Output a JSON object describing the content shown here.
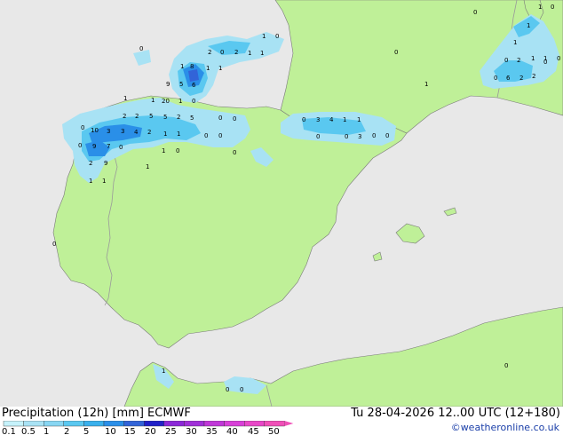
{
  "title": "Precipitation (12h) [mm] ECMWF",
  "datetime": "Tu 28-04-2026 12..00 UTC (12+180)",
  "credit": "©weatheronline.co.uk",
  "colors": {
    "sea": "#e8e8e8",
    "land": "#bff098",
    "light_precip": "#a8e2f4",
    "mid_precip": "#5ac8f0",
    "heavy_precip": "#2a8fe8",
    "very_heavy_precip": "#3264d8",
    "border": "#9a9a9a",
    "coast": "#7a7a7a"
  },
  "legend": {
    "labels": [
      "0.1",
      "0.5",
      "1",
      "2",
      "5",
      "10",
      "15",
      "20",
      "25",
      "30",
      "35",
      "40",
      "45",
      "50"
    ],
    "colors": [
      "#c6f2fb",
      "#a8e2f4",
      "#88d6f2",
      "#5ac8f0",
      "#3ab0ec",
      "#2a8fe8",
      "#3264d8",
      "#2020c8",
      "#8c28d8",
      "#a030d8",
      "#c038d8",
      "#d840d8",
      "#e848c8",
      "#f050b8"
    ]
  },
  "values": [
    {
      "t": "1"
    },
    {
      "t": "0"
    },
    {
      "t": "0"
    },
    {
      "t": "2"
    },
    {
      "t": "2"
    },
    {
      "t": "1"
    },
    {
      "t": "1"
    },
    {
      "t": "0"
    },
    {
      "t": "0"
    },
    {
      "t": "1"
    },
    {
      "t": "8"
    },
    {
      "t": "1"
    },
    {
      "t": "1"
    },
    {
      "t": "9"
    },
    {
      "t": "5"
    },
    {
      "t": "6"
    },
    {
      "t": "1"
    },
    {
      "t": "1"
    },
    {
      "t": "20"
    },
    {
      "t": "1"
    },
    {
      "t": "0"
    },
    {
      "t": "2"
    },
    {
      "t": "2"
    },
    {
      "t": "5"
    },
    {
      "t": "5"
    },
    {
      "t": "2"
    },
    {
      "t": "5"
    },
    {
      "t": "0"
    },
    {
      "t": "0"
    },
    {
      "t": "0"
    },
    {
      "t": "10"
    },
    {
      "t": "3"
    },
    {
      "t": "3"
    },
    {
      "t": "4"
    },
    {
      "t": "2"
    },
    {
      "t": "1"
    },
    {
      "t": "1"
    },
    {
      "t": "0"
    },
    {
      "t": "0"
    },
    {
      "t": "0"
    },
    {
      "t": "9"
    },
    {
      "t": "7"
    },
    {
      "t": "0"
    },
    {
      "t": "1"
    },
    {
      "t": "0"
    },
    {
      "t": "0"
    },
    {
      "t": "2"
    },
    {
      "t": "9"
    },
    {
      "t": "1"
    },
    {
      "t": "1"
    },
    {
      "t": "1"
    },
    {
      "t": "0"
    },
    {
      "t": "3"
    },
    {
      "t": "4"
    },
    {
      "t": "1"
    },
    {
      "t": "1"
    },
    {
      "t": "0"
    },
    {
      "t": "0"
    },
    {
      "t": "3"
    },
    {
      "t": "0"
    },
    {
      "t": "0"
    },
    {
      "t": "0"
    },
    {
      "t": "1"
    },
    {
      "t": "0"
    },
    {
      "t": "1"
    },
    {
      "t": "1"
    },
    {
      "t": "0"
    },
    {
      "t": "1"
    },
    {
      "t": "0"
    },
    {
      "t": "2"
    },
    {
      "t": "0"
    },
    {
      "t": "1"
    },
    {
      "t": "0"
    },
    {
      "t": "6"
    },
    {
      "t": "2"
    },
    {
      "t": "2"
    },
    {
      "t": "1"
    },
    {
      "t": "0"
    },
    {
      "t": "0"
    },
    {
      "t": "1"
    },
    {
      "t": "0"
    },
    {
      "t": "0"
    }
  ]
}
